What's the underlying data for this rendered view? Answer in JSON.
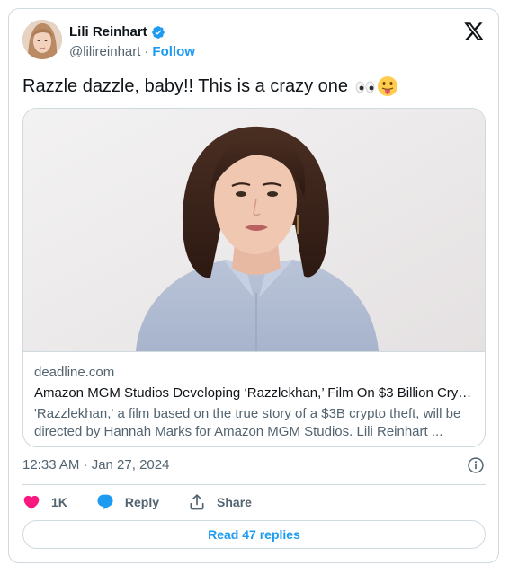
{
  "author": {
    "name": "Lili Reinhart",
    "handle": "@lilireinhart",
    "separator": "·",
    "follow_label": "Follow",
    "verified_color": "#1d9bf0"
  },
  "tweet": {
    "text": "Razzle dazzle, baby!! This is a crazy one"
  },
  "link_card": {
    "domain": "deadline.com",
    "title": "Amazon MGM Studios Developing ‘Razzlekhan,’ Film On $3 Billion Crypt...",
    "description": "'Razzlekhan,' a film based on the true story of a $3B crypto theft, will be directed by Hannah Marks for Amazon MGM Studios. Lili Reinhart ..."
  },
  "meta": {
    "timestamp": "12:33 AM · Jan 27, 2024"
  },
  "actions": {
    "like_count": "1K",
    "reply_label": "Reply",
    "share_label": "Share"
  },
  "footer": {
    "read_replies_label": "Read 47 replies"
  },
  "icons": {
    "brand": "x-logo-icon",
    "verified": "verified-badge-icon",
    "info": "info-icon",
    "like": "heart-icon",
    "reply": "speech-bubble-icon",
    "share": "share-arrow-icon"
  },
  "colors": {
    "accent": "#1d9bf0",
    "like": "#f91880",
    "muted": "#536471",
    "border": "#cfd9de",
    "text": "#0f1419"
  }
}
